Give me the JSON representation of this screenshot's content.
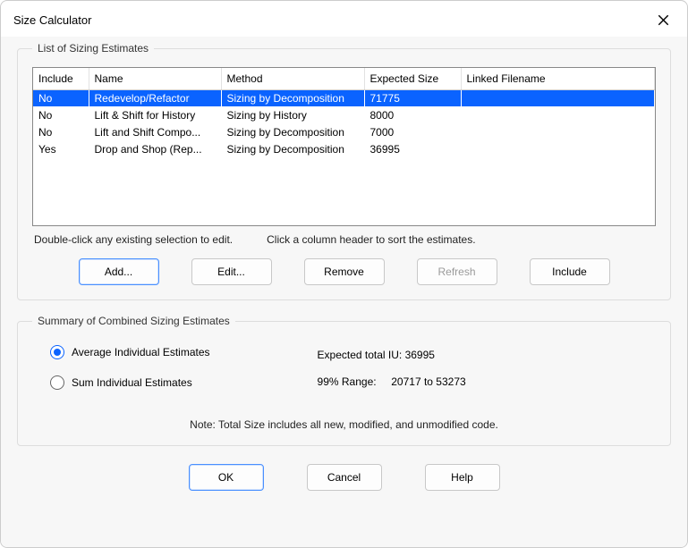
{
  "window": {
    "title": "Size Calculator"
  },
  "list_group": {
    "legend": "List of Sizing Estimates",
    "columns": {
      "include": "Include",
      "name": "Name",
      "method": "Method",
      "expected_size": "Expected Size",
      "linked_filename": "Linked Filename"
    },
    "rows": [
      {
        "include": "No",
        "name": "Redevelop/Refactor",
        "method": "Sizing by Decomposition",
        "expected_size": "71775",
        "linked_filename": ""
      },
      {
        "include": "No",
        "name": "Lift & Shift for History",
        "method": "Sizing by History",
        "expected_size": "8000",
        "linked_filename": ""
      },
      {
        "include": "No",
        "name": "Lift and Shift Compo...",
        "method": "Sizing by Decomposition",
        "expected_size": "7000",
        "linked_filename": ""
      },
      {
        "include": "Yes",
        "name": "Drop and Shop (Rep...",
        "method": "Sizing by Decomposition",
        "expected_size": "36995",
        "linked_filename": ""
      }
    ],
    "hint1": "Double-click any existing selection to edit.",
    "hint2": "Click a column header to sort the estimates.",
    "buttons": {
      "add": "Add...",
      "edit": "Edit...",
      "remove": "Remove",
      "refresh": "Refresh",
      "include": "Include"
    }
  },
  "summary_group": {
    "legend": "Summary of Combined Sizing Estimates",
    "radio_average": "Average Individual Estimates",
    "radio_sum": "Sum Individual Estimates",
    "expected_label": "Expected total IU: 36995",
    "range_label": "99% Range:",
    "range_value": "20717 to 53273",
    "note": "Note:  Total Size includes all new, modified, and unmodified code."
  },
  "bottom": {
    "ok": "OK",
    "cancel": "Cancel",
    "help": "Help"
  }
}
